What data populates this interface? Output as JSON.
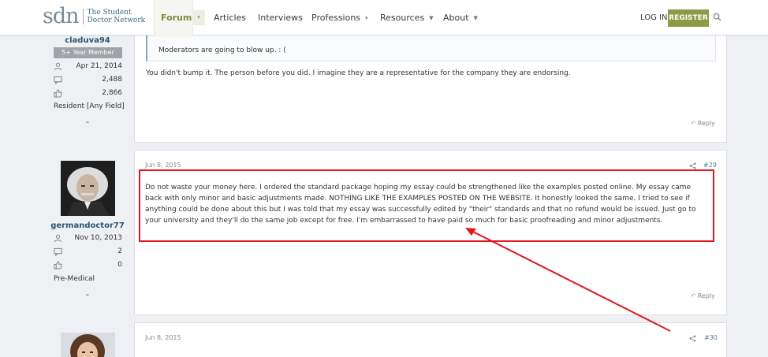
{
  "nav": {
    "logo_mark": "sdn",
    "logo_line1": "The Student",
    "logo_line2": "Doctor Network",
    "items": [
      "Forums",
      "Articles",
      "Interviews",
      "Professions",
      "Resources",
      "About"
    ],
    "login": "LOG IN",
    "register": "REGISTER",
    "icons": {
      "search": "search-icon",
      "dropdown": "chevron-down-icon"
    }
  },
  "post_prev": {
    "user": {
      "name": "claduva94",
      "badge": "5+ Year Member",
      "joined": "Apr 21, 2014",
      "messages": "2,488",
      "likes": "2,866",
      "role": "Resident [Any Field]"
    },
    "quote": "Moderators are going to blow up. : (",
    "message": "You didn't bump it. The person before you did. I imagine they are a representative for the company they are endorsing.",
    "reply": "Reply"
  },
  "post_29": {
    "user": {
      "name": "germandoctor77",
      "joined": "Nov 10, 2013",
      "messages": "2",
      "likes": "0",
      "role": "Pre-Medical"
    },
    "date": "Jun 8, 2015",
    "number": "#29",
    "message": "Do not waste your money here. I ordered the standard package hoping my essay could be strengthened like the examples posted online. My essay came back with only minor and basic adjustments made. NOTHING LIKE THE EXAMPLES POSTED ON THE WEBSITE. It honestly looked the same. I tried to see if anything could be done about this but I was told that my essay was successfully edited by \"their\" standards and that no refund would be issued. Just go to your university and they'll do the same job except for free. I'm embarrassed to have paid so much for basic proofreading and minor adjustments.",
    "reply": "Reply"
  },
  "post_30": {
    "date": "Jun 8, 2015",
    "number": "#30"
  },
  "annotation": {
    "color": "#e1161e"
  },
  "colors": {
    "accent": "#8c9b45",
    "link": "#2b5677",
    "background": "#eef0f3"
  }
}
